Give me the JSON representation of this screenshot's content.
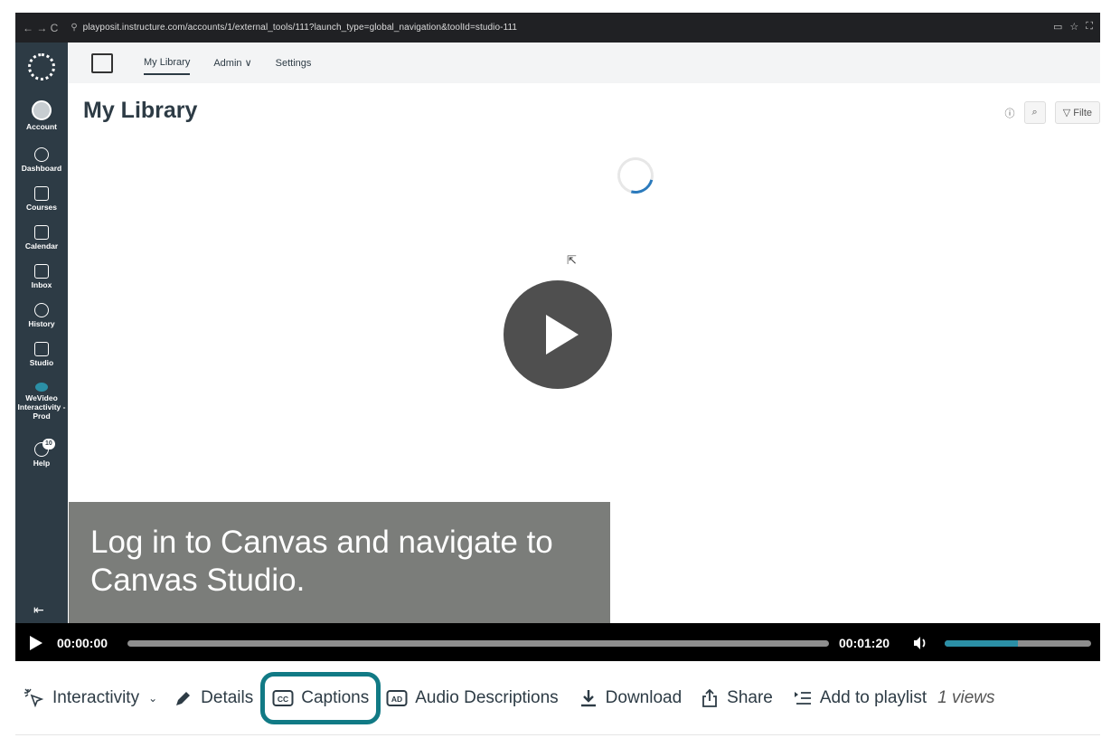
{
  "browser": {
    "url": "playposit.instructure.com/accounts/1/external_tools/111?launch_type=global_navigation&toolId=studio-111"
  },
  "canvas_nav": {
    "items": [
      {
        "label": "Account",
        "icon": "account-icon"
      },
      {
        "label": "Dashboard",
        "icon": "dashboard-icon"
      },
      {
        "label": "Courses",
        "icon": "courses-icon"
      },
      {
        "label": "Calendar",
        "icon": "calendar-icon"
      },
      {
        "label": "Inbox",
        "icon": "inbox-icon"
      },
      {
        "label": "History",
        "icon": "history-icon"
      },
      {
        "label": "Studio",
        "icon": "studio-icon"
      },
      {
        "label": "WeVideo Interactivity - Prod",
        "icon": "wevideo-icon"
      },
      {
        "label": "Help",
        "icon": "help-icon",
        "badge": "10"
      }
    ]
  },
  "studio": {
    "tabs": [
      {
        "label": "My Library",
        "active": true
      },
      {
        "label": "Admin ∨",
        "active": false
      },
      {
        "label": "Settings",
        "active": false
      }
    ],
    "page_title": "My Library",
    "filter_label": "Filte"
  },
  "video": {
    "caption": "Log in to Canvas and navigate to Canvas Studio.",
    "current_time": "00:00:00",
    "duration": "00:01:20",
    "progress": 0.0,
    "volume": 0.5
  },
  "actions": {
    "interactivity": "Interactivity",
    "details": "Details",
    "captions": "Captions",
    "audio_descriptions": "Audio Descriptions",
    "download": "Download",
    "share": "Share",
    "add_to_playlist": "Add to playlist",
    "views": "1 views"
  },
  "colors": {
    "canvas_nav_bg": "#2d3b45",
    "highlight": "#117a85",
    "volume_fill": "#2b8fa6"
  }
}
